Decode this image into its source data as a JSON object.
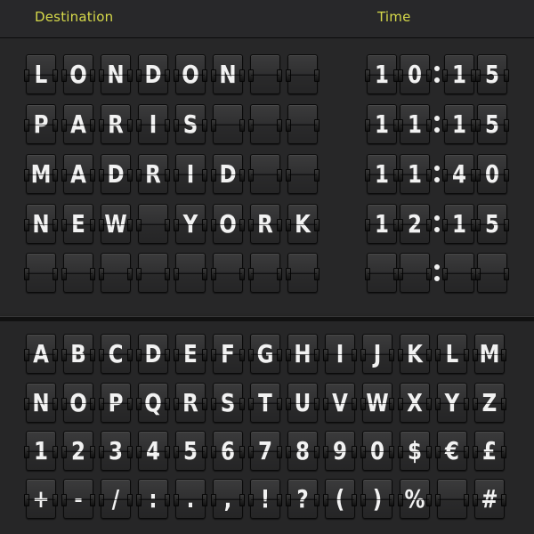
{
  "header": {
    "destination_label": "Destination",
    "time_label": "Time"
  },
  "colors": {
    "header_text": "#d6d94a",
    "background": "#262627",
    "tile_text": "#f2f2f2"
  },
  "board": {
    "rows": [
      {
        "destination": "LONDON",
        "time": [
          "1",
          "0",
          "1",
          "5"
        ],
        "time_text": "10:15"
      },
      {
        "destination": "PARIS",
        "time": [
          "1",
          "1",
          "1",
          "5"
        ],
        "time_text": "11:15"
      },
      {
        "destination": "MADRID",
        "time": [
          "1",
          "1",
          "4",
          "0"
        ],
        "time_text": "11:40"
      },
      {
        "destination": "NEW YORK",
        "time": [
          "1",
          "2",
          "1",
          "5"
        ],
        "time_text": "12:15"
      },
      {
        "destination": "",
        "time": [
          "",
          "",
          "",
          ""
        ],
        "time_text": ""
      }
    ],
    "destination_tile_count": 8
  },
  "character_set": {
    "rows": [
      [
        "A",
        "B",
        "C",
        "D",
        "E",
        "F",
        "G",
        "H",
        "I",
        "J",
        "K",
        "L",
        "M"
      ],
      [
        "N",
        "O",
        "P",
        "Q",
        "R",
        "S",
        "T",
        "U",
        "V",
        "W",
        "X",
        "Y",
        "Z"
      ],
      [
        "1",
        "2",
        "3",
        "4",
        "5",
        "6",
        "7",
        "8",
        "9",
        "0",
        "$",
        "€",
        "£"
      ],
      [
        "+",
        "-",
        "/",
        ":",
        ".",
        ",",
        "!",
        "?",
        "(",
        ")",
        "%",
        "",
        "#"
      ]
    ]
  }
}
